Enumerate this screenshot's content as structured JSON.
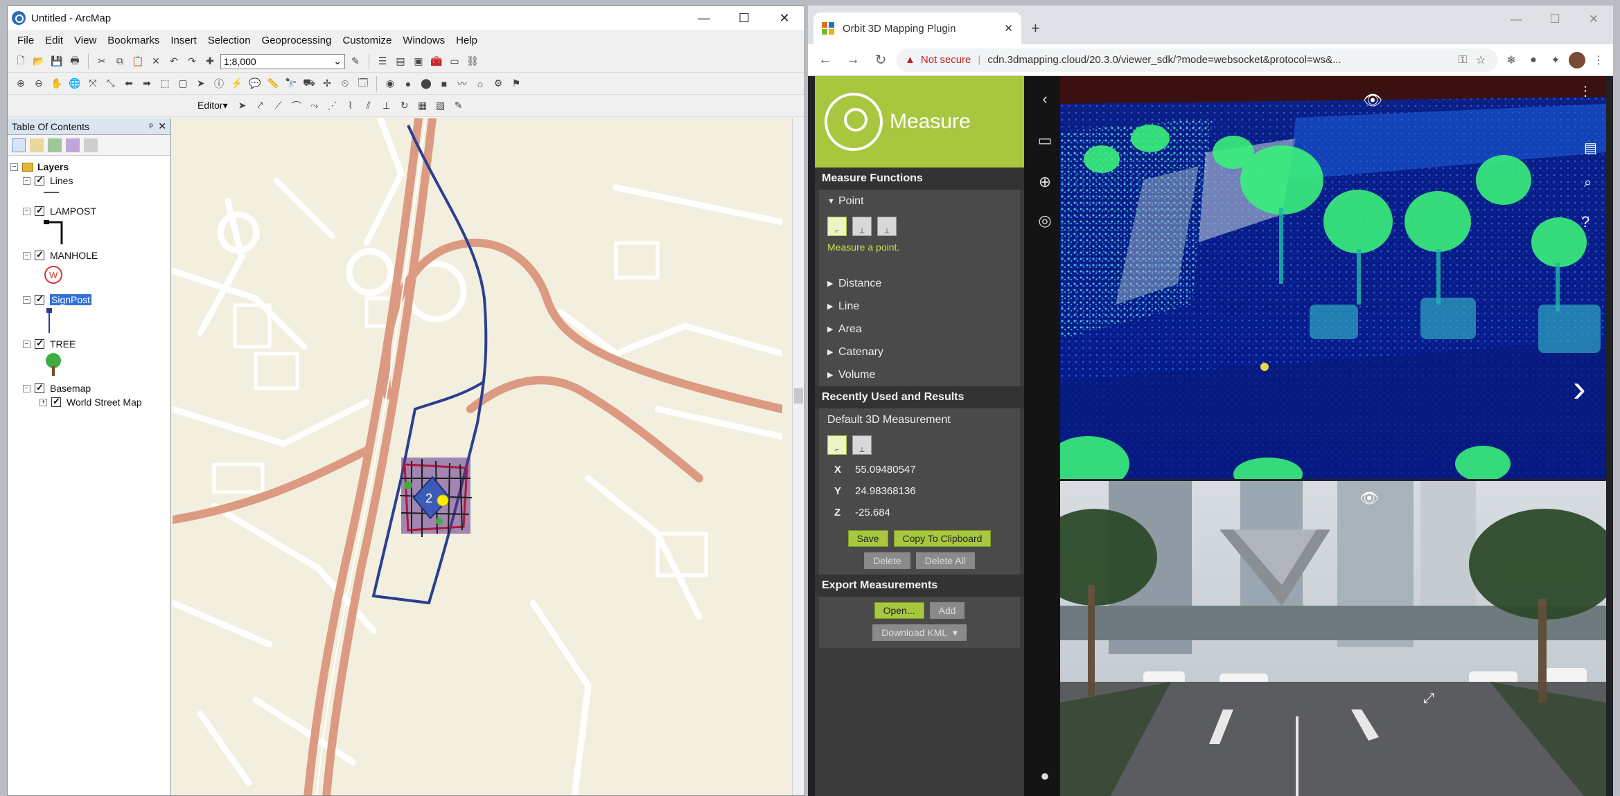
{
  "arcmap": {
    "title": "Untitled - ArcMap",
    "window_controls": {
      "minimize": "—",
      "maximize": "☐",
      "close": "✕"
    },
    "menu": [
      "File",
      "Edit",
      "View",
      "Bookmarks",
      "Insert",
      "Selection",
      "Geoprocessing",
      "Customize",
      "Windows",
      "Help"
    ],
    "scale_value": "1:8,000",
    "editor_label": "Editor▾",
    "toc": {
      "title": "Table Of Contents",
      "pin": "ᵖ",
      "close": "✕",
      "root": "Layers",
      "layers": [
        "Lines",
        "LAMPOST",
        "MANHOLE",
        "SignPost",
        "TREE",
        "Basemap"
      ],
      "basemap_child": "World Street Map",
      "selected_layer": "SignPost"
    },
    "map_label": "2"
  },
  "browser": {
    "tab_title": "Orbit 3D Mapping Plugin",
    "tab_close": "✕",
    "new_tab": "+",
    "window_controls": {
      "minimize": "—",
      "maximize": "☐",
      "close": "✕"
    },
    "security": "Not secure",
    "url": "cdn.3dmapping.cloud/20.3.0/viewer_sdk/?mode=websocket&protocol=ws&..."
  },
  "measure": {
    "brand_title": "Measure",
    "functions_header": "Measure Functions",
    "point_label": "Point",
    "point_hint": "Measure a point.",
    "functions": [
      "Distance",
      "Line",
      "Area",
      "Catenary",
      "Volume"
    ],
    "results_header": "Recently Used and Results",
    "default_measurement": "Default 3D Measurement",
    "coords": [
      {
        "axis": "X",
        "value": "55.09480547"
      },
      {
        "axis": "Y",
        "value": "24.98368136"
      },
      {
        "axis": "Z",
        "value": "-25.684"
      }
    ],
    "buttons": {
      "save": "Save",
      "copy": "Copy To Clipboard",
      "delete": "Delete",
      "delete_all": "Delete All"
    },
    "export_header": "Export Measurements",
    "export_buttons": {
      "open": "Open...",
      "add": "Add",
      "download": "Download KML"
    }
  },
  "colors": {
    "accent": "#a8c73f",
    "panel": "#3b3b3b",
    "road": "#dc9a82",
    "track": "#2a3f8f"
  }
}
